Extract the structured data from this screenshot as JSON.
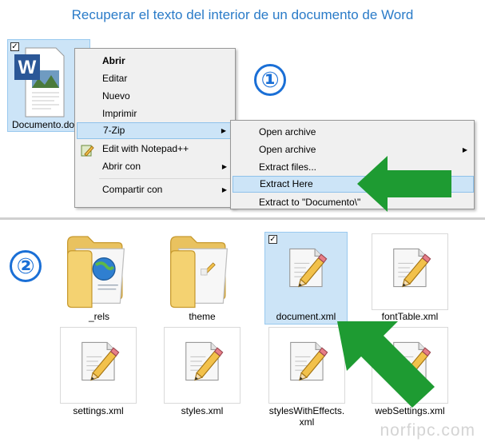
{
  "title": "Recuperar el texto del interior de un documento de Word",
  "step1": {
    "badge": "①",
    "file": {
      "label": "Documento.do",
      "checked": "✓",
      "icon": "word-document-icon"
    },
    "context_menu": {
      "items": [
        {
          "label": "Abrir"
        },
        {
          "label": "Editar"
        },
        {
          "label": "Nuevo"
        },
        {
          "label": "Imprimir"
        },
        {
          "label": "7-Zip",
          "arrow": "▶"
        },
        {
          "label": "Edit with Notepad++"
        },
        {
          "label": "Abrir con",
          "arrow": "▶"
        },
        {
          "label": "Compartir con",
          "arrow": "▶"
        }
      ]
    },
    "submenu": {
      "items": [
        {
          "label": "Open archive"
        },
        {
          "label": "Open archive",
          "arrow": "▶"
        },
        {
          "label": "Extract files..."
        },
        {
          "label": "Extract Here"
        },
        {
          "label": "Extract to \"Documento\\\""
        }
      ]
    },
    "arrow_color": "#1e9b32"
  },
  "step2": {
    "badge": "②",
    "items": [
      {
        "label": "_rels",
        "icon": "folder-with-web-page-icon"
      },
      {
        "label": "theme",
        "icon": "folder-icon"
      },
      {
        "label": "document.xml",
        "icon": "xml-file-icon",
        "checked": "✓"
      },
      {
        "label": "fontTable.xml",
        "icon": "xml-file-icon"
      },
      {
        "label": "settings.xml",
        "icon": "xml-file-icon"
      },
      {
        "label": "styles.xml",
        "icon": "xml-file-icon"
      },
      {
        "label": "stylesWithEffects.",
        "label2": "xml",
        "icon": "xml-file-icon"
      },
      {
        "label": "webSettings.xml",
        "icon": "xml-file-icon"
      }
    ]
  },
  "colors": {
    "title": "#2a7bc8",
    "badge": "#1a6fd6",
    "selection": "#cce4f7",
    "green_arrow": "#1e9b32"
  },
  "watermark": "norfipc.com"
}
